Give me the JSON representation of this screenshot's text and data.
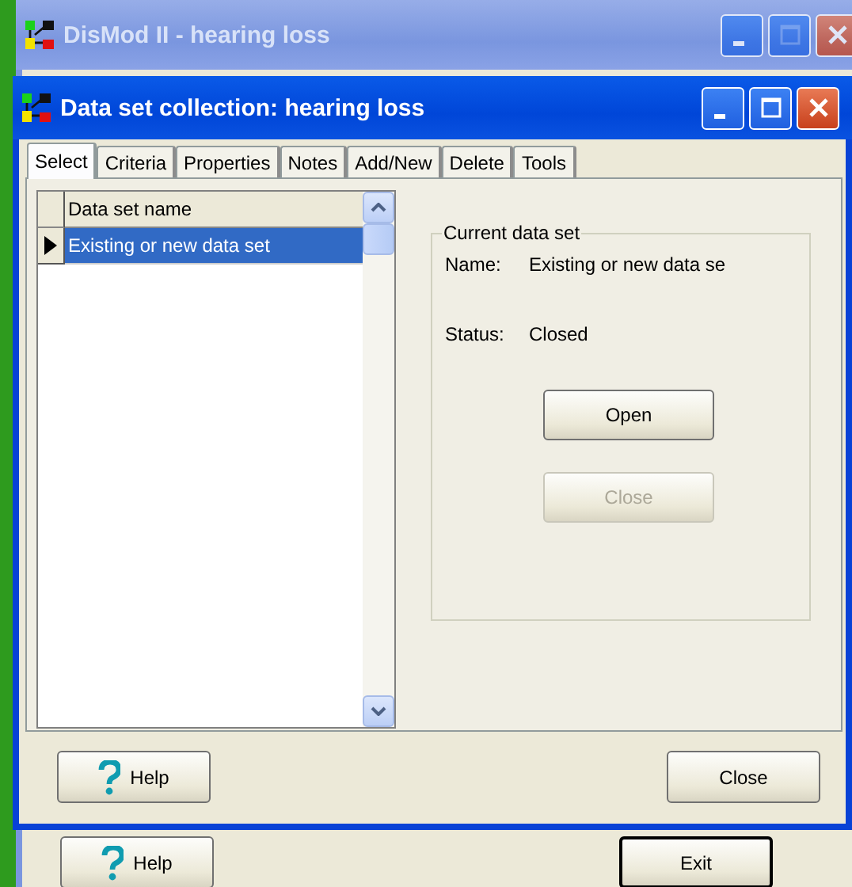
{
  "background_window": {
    "title": "DisMod II - hearing loss",
    "active": false,
    "maximize_disabled": true,
    "buttons": [
      {
        "label": "Help",
        "kind": "help"
      },
      {
        "label": "Exit",
        "kind": "default"
      }
    ]
  },
  "dialog": {
    "title": "Data set collection: hearing loss",
    "active": true,
    "maximize_disabled": false,
    "tabs": [
      {
        "label": "Select",
        "selected": true
      },
      {
        "label": "Criteria",
        "selected": false
      },
      {
        "label": "Properties",
        "selected": false
      },
      {
        "label": "Notes",
        "selected": false
      },
      {
        "label": "Add/New",
        "selected": false
      },
      {
        "label": "Delete",
        "selected": false
      },
      {
        "label": "Tools",
        "selected": false
      }
    ],
    "grid": {
      "columns": [
        "Data set name"
      ],
      "rows": [
        {
          "cells": [
            "Existing or new data set"
          ],
          "selected": true
        }
      ]
    },
    "group": {
      "title": "Current data set",
      "fields": [
        {
          "label": "Name:",
          "value": "Existing or new data se"
        },
        {
          "label": "Status:",
          "value": "Closed"
        }
      ],
      "buttons": [
        {
          "label": "Open",
          "disabled": false
        },
        {
          "label": "Close",
          "disabled": true
        }
      ]
    },
    "buttons": [
      {
        "label": "Help",
        "kind": "help"
      },
      {
        "label": "Close",
        "kind": "normal"
      }
    ]
  }
}
